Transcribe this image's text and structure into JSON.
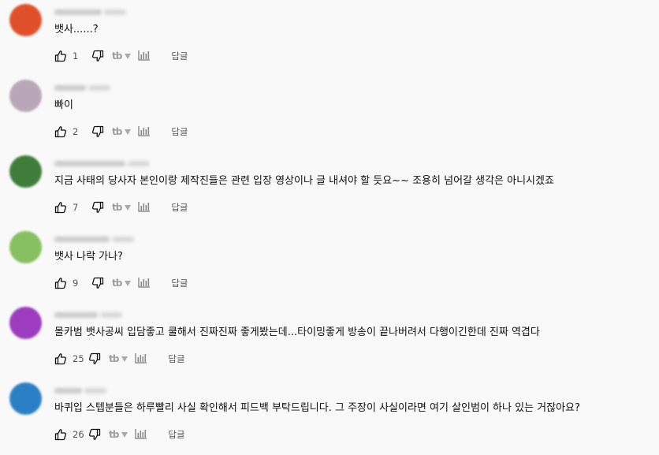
{
  "comments": [
    {
      "text": "뱃사......?",
      "likes": "1",
      "reply_label": "답글",
      "avatar_color": "#e0512b",
      "author_hint": "sbqp·sc 1년 전"
    },
    {
      "text": "빠이",
      "likes": "2",
      "reply_label": "답글",
      "avatar_color": "#b8a7b8",
      "author_hint": "dkg 1년 전"
    },
    {
      "text": "지금 사태의 당사자 본인이랑 제작진들은 관련 입장 영상이나 글 내셔야 할 듯요~~ 조용히 넘어갈 생각은 아니시겠죠",
      "likes": "7",
      "reply_label": "답글",
      "avatar_color": "#3f7d3a",
      "author_hint": "한 ·0대·00000 1년 전"
    },
    {
      "text": "뱃사 나락 가나?",
      "likes": "9",
      "reply_label": "답글",
      "avatar_color": "#86c060",
      "author_hint": "1012대 ·ssp 1년 전"
    },
    {
      "text": "몰카범 뱃사공씨 입담좋고 쿨해서 진짜진짜 좋게봤는데...타이밍좋게 방송이 끝나버려서 다행이긴한데 진짜 역겹다",
      "likes": "25",
      "reply_label": "답글",
      "avatar_color": "#9b3dbe",
      "author_hint": "정다움루 ·1·2 1년 전"
    },
    {
      "text": "바퀴입 스텝분들은 하루빨리 사실 확인해서 피드백 부탁드립니다. 그 주장이 사실이라면 여기 살인범이 하나 있는 거잖아요?",
      "likes": "26",
      "reply_label": "답글",
      "avatar_color": "#2b80c5",
      "author_hint": "1년 전"
    }
  ],
  "icons": {
    "like": "thumb-up-icon",
    "dislike": "thumb-down-icon",
    "extension": "tb-logo-icon",
    "dropdown": "triangle-down-icon",
    "stats": "bar-chart-icon"
  }
}
